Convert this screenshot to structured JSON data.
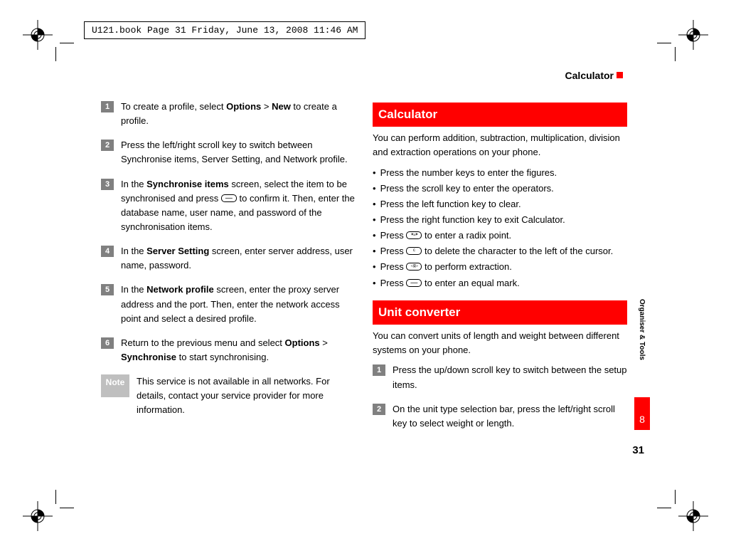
{
  "print_header": "U121.book  Page 31  Friday, June 13, 2008  11:46 AM",
  "running_head": "Calculator",
  "side_label": "Organiser & Tools",
  "side_tab": "8",
  "page_num": "31",
  "left": {
    "steps": [
      {
        "n": "1",
        "body_pre": "To create a profile, select ",
        "b1": "Options",
        "mid": " > ",
        "b2": "New",
        "post": " to create a profile."
      },
      {
        "n": "2",
        "plain": "Press the left/right scroll key to switch between Synchronise items, Server Setting, and Network profile."
      },
      {
        "n": "3",
        "pre": "In the ",
        "b": "Synchronise items",
        "post": " screen, select the item to be synchronised and press ",
        "post2": " to confirm it. Then, enter the database name, user name, and password of the synchronisation items."
      },
      {
        "n": "4",
        "pre": "In the ",
        "b": "Server Setting",
        "post": " screen, enter server address,  user name, password."
      },
      {
        "n": "5",
        "pre": "In the ",
        "b": "Network profile",
        "post": " screen, enter the proxy server address and the port. Then, enter the network access point and select a desired profile."
      },
      {
        "n": "6",
        "pre": "Return to the previous menu and select ",
        "b1": "Options",
        "mid": " > ",
        "b2": "Synchronise",
        "post": " to start synchronising."
      }
    ],
    "note_label": " Note",
    "note_body": "This service is not available in all networks. For details, contact your service provider for more information."
  },
  "right": {
    "sec1": "Calculator",
    "sec1_intro": "You can perform addition, subtraction, multiplication, division and extraction operations on your phone.",
    "b1": "Press the number keys to enter the figures.",
    "b2": "Press the scroll key to enter the operators.",
    "b3": "Press the left function key to clear.",
    "b4": "Press the right function key to exit Calculator.",
    "b5_pre": "Press ",
    "b5_post": " to enter a radix point.",
    "b6_pre": "Press ",
    "b6_post": " to delete the character to the left of the cursor.",
    "b7_pre": "Press ",
    "b7_post": " to perform extraction.",
    "b8_pre": "Press ",
    "b8_post": " to enter an equal mark.",
    "sec2": "Unit converter",
    "sec2_intro": "You can convert units of length and weight between different systems on your phone.",
    "steps": [
      {
        "n": "1",
        "plain": "Press the up/down scroll key to switch between the setup items."
      },
      {
        "n": "2",
        "plain": "On the unit type selection bar, press the left/right scroll key to select weight or length."
      }
    ]
  }
}
